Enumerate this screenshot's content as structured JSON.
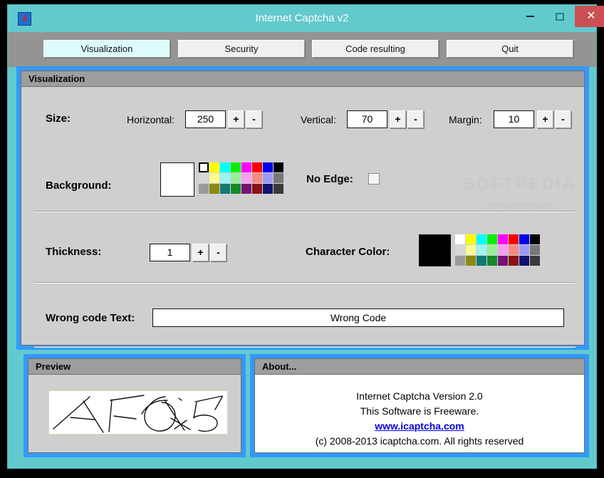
{
  "window": {
    "title": "Internet Captcha v2",
    "icon_name": "app-icon-4",
    "icon_glyph": "4",
    "minimize_label": "",
    "maximize_label": "",
    "close_label": "✕",
    "titlebar_color": "#62c9cd",
    "close_color": "#cb5055"
  },
  "tabs": [
    {
      "label": "Visualization",
      "active": true
    },
    {
      "label": "Security",
      "active": false
    },
    {
      "label": "Code resulting",
      "active": false
    },
    {
      "label": "Quit",
      "active": false
    }
  ],
  "main": {
    "group_title": "Visualization",
    "accent_color": "#3399fc",
    "size": {
      "label": "Size:",
      "horizontal": {
        "label": "Horizontal:",
        "value": "250",
        "plus": "+",
        "minus": "-"
      },
      "vertical": {
        "label": "Vertical:",
        "value": "70",
        "plus": "+",
        "minus": "-"
      },
      "margin": {
        "label": "Margin:",
        "value": "10",
        "plus": "+",
        "minus": "-"
      }
    },
    "background": {
      "label": "Background:",
      "selected_color": "#ffffff",
      "selected_index": 0,
      "palette": [
        "#ffffff",
        "#ffff00",
        "#00ffff",
        "#00f000",
        "#ff00ff",
        "#fa0000",
        "#0000f0",
        "#000000",
        "#d7d7d7",
        "#fbfb94",
        "#99f4f4",
        "#96ef96",
        "#f79ff0",
        "#f88b7f",
        "#9b9bf5",
        "#787878",
        "#9a9a9a",
        "#8a8a12",
        "#127878",
        "#128a28",
        "#761176",
        "#8a1212",
        "#121270",
        "#3a3a3a"
      ]
    },
    "no_edge": {
      "label": "No Edge:",
      "checked": false
    },
    "thickness": {
      "label": "Thickness:",
      "value": "1",
      "plus": "+",
      "minus": "-"
    },
    "character_color": {
      "label": "Character Color:",
      "selected_color": "#000000",
      "selected_index": 7,
      "palette": [
        "#ffffff",
        "#ffff00",
        "#00ffff",
        "#00f000",
        "#ff00ff",
        "#fa0000",
        "#0000f0",
        "#000000",
        "#d7d7d7",
        "#fbfb94",
        "#99f4f4",
        "#96ef96",
        "#f79ff0",
        "#f88b7f",
        "#9b9bf5",
        "#787878",
        "#9a9a9a",
        "#8a8a12",
        "#127878",
        "#128a28",
        "#761176",
        "#8a1212",
        "#121270",
        "#3a3a3a"
      ]
    },
    "wrong_code": {
      "label": "Wrong code Text:",
      "value": "Wrong Code",
      "placeholder": "Wrong Code"
    }
  },
  "watermark": {
    "big": "SOFTPEDIA",
    "small": "www.softpedia.com"
  },
  "preview": {
    "title": "Preview",
    "captcha_text": "AF615"
  },
  "about": {
    "title": "About...",
    "line1": "Internet Captcha Version 2.0",
    "line2": "This Software is Freeware.",
    "link": "www.icaptcha.com",
    "line4": "(c) 2008-2013 icaptcha.com. All rights reserved"
  }
}
